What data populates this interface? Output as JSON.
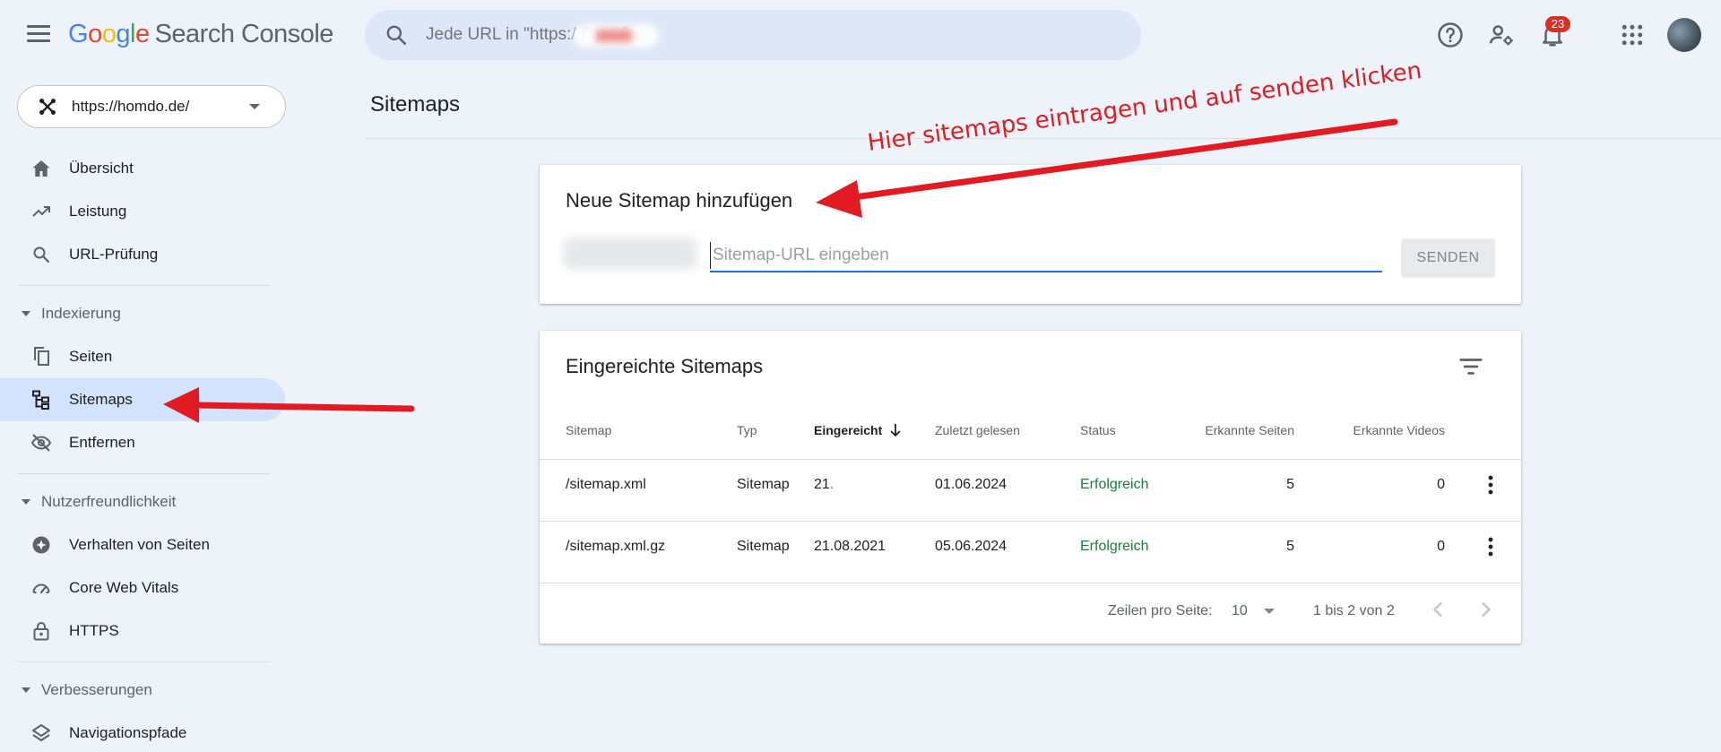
{
  "header": {
    "logo_letters": [
      "G",
      "o",
      "o",
      "g",
      "l",
      "e"
    ],
    "product": "Search Console",
    "search_placeholder": "Jede URL in \"https:/ /\" prüfen",
    "notification_count": "23"
  },
  "sidebar": {
    "property": "https://homdo.de/",
    "items_top": [
      {
        "label": "Übersicht"
      },
      {
        "label": "Leistung"
      },
      {
        "label": "URL-Prüfung"
      }
    ],
    "section_indexing": "Indexierung",
    "items_indexing": [
      {
        "label": "Seiten"
      },
      {
        "label": "Sitemaps"
      },
      {
        "label": "Entfernen"
      }
    ],
    "section_ux": "Nutzerfreundlichkeit",
    "items_ux": [
      {
        "label": "Verhalten von Seiten"
      },
      {
        "label": "Core Web Vitals"
      },
      {
        "label": "HTTPS"
      }
    ],
    "section_improvements": "Verbesserungen",
    "items_improvements": [
      {
        "label": "Navigationspfade"
      }
    ]
  },
  "main": {
    "title": "Sitemaps",
    "add_card": {
      "title": "Neue Sitemap hinzufügen",
      "input_placeholder": "Sitemap-URL eingeben",
      "send_label": "SENDEN"
    },
    "table_card": {
      "title": "Eingereichte Sitemaps",
      "headers": {
        "sitemap": "Sitemap",
        "type": "Typ",
        "submitted": "Eingereicht",
        "last_read": "Zuletzt gelesen",
        "status": "Status",
        "pages": "Erkannte Seiten",
        "videos": "Erkannte Videos"
      },
      "rows": [
        {
          "sitemap": "/sitemap.xml",
          "type": "Sitemap",
          "submitted": "21.",
          "last_read": "01.06.2024",
          "status": "Erfolgreich",
          "pages": "5",
          "videos": "0"
        },
        {
          "sitemap": "/sitemap.xml.gz",
          "type": "Sitemap",
          "submitted": "21.08.2021",
          "last_read": "05.06.2024",
          "status": "Erfolgreich",
          "pages": "5",
          "videos": "0"
        }
      ],
      "rows_per_page_label": "Zeilen pro Seite:",
      "rows_per_page_value": "10",
      "range_text": "1 bis 2 von 2"
    }
  },
  "annotation": {
    "text": "Hier sitemaps eintragen und auf senden klicken",
    "color": "#e21b23"
  },
  "colors": {
    "accent": "#1a73e8",
    "success": "#188038",
    "active_nav": "#d3e3fd",
    "background": "#eef2f9"
  }
}
